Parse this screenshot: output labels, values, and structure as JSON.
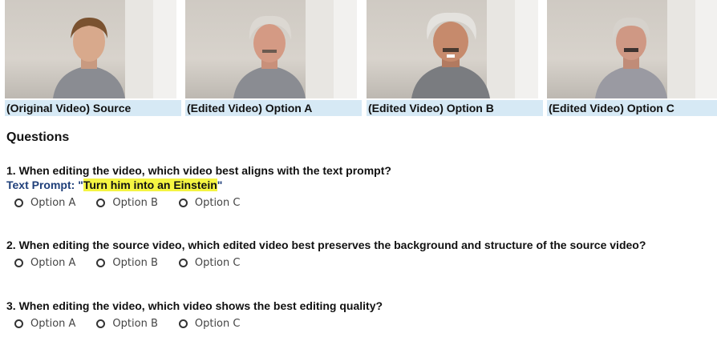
{
  "videos": [
    {
      "caption": "(Original Video) Source"
    },
    {
      "caption": "(Edited Video) Option A"
    },
    {
      "caption": "(Edited Video) Option B"
    },
    {
      "caption": "(Edited Video) Option C"
    }
  ],
  "questions_title": "Questions",
  "questions": [
    {
      "text": "1. When editing the video, which video best aligns with the text prompt?",
      "prompt_label": "Text Prompt: \"",
      "prompt_value": "Turn him into an Einstein",
      "prompt_close": "\"",
      "options": [
        "Option A",
        "Option B",
        "Option C"
      ]
    },
    {
      "text": "2. When editing the source video, which edited video best preserves the background and structure of the source video?",
      "options": [
        "Option A",
        "Option B",
        "Option C"
      ]
    },
    {
      "text": "3. When editing the video, which video shows the best editing quality?",
      "options": [
        "Option A",
        "Option B",
        "Option C"
      ]
    }
  ],
  "colors": {
    "caption_bg": "#d6e9f5",
    "highlight": "#f5f542",
    "prompt_text": "#1f3f7a"
  }
}
